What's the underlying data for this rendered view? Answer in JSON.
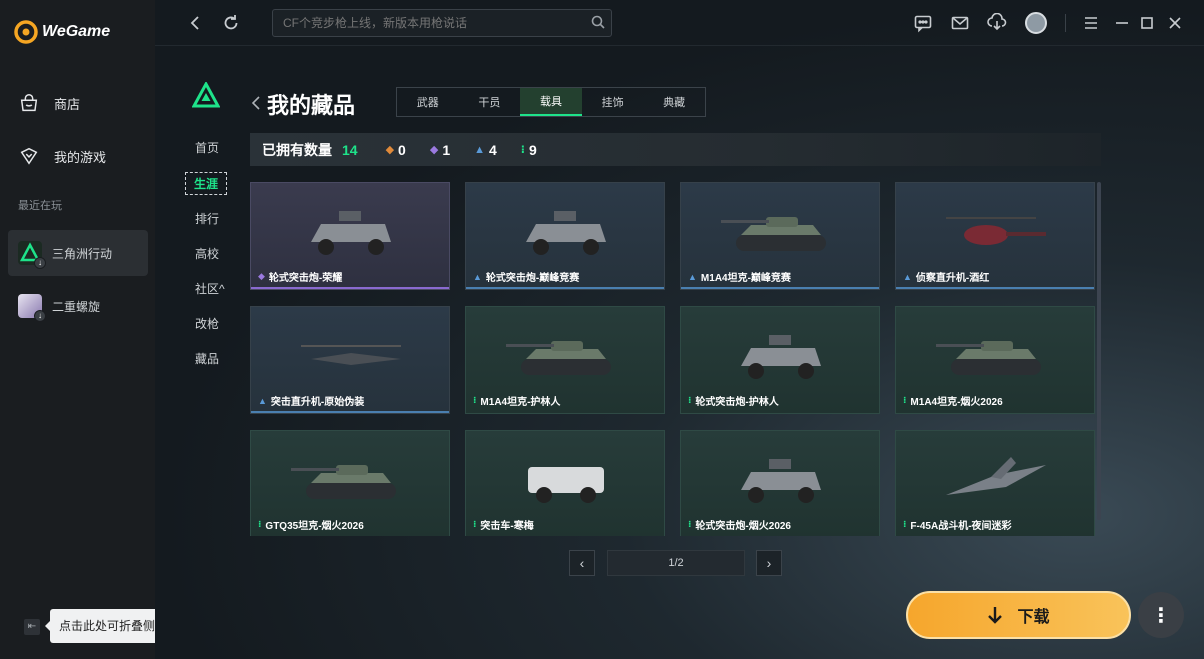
{
  "app": {
    "logo_text": "WeGame",
    "colors": {
      "accent": "#1ee38a",
      "download": "#f6a62c"
    }
  },
  "sidebar": {
    "nav": [
      {
        "label": "商店",
        "icon": "shop-bag-icon"
      },
      {
        "label": "我的游戏",
        "icon": "gamepad-icon"
      }
    ],
    "recent_label": "最近在玩",
    "recent_games": [
      {
        "label": "三角洲行动",
        "active": true
      },
      {
        "label": "二重螺旋",
        "active": false
      }
    ],
    "collapse_tip": "点击此处可折叠侧边栏"
  },
  "topbar": {
    "search_placeholder": "CF个竞步枪上线，新版本用枪说话",
    "icons": [
      "back-icon",
      "refresh-icon",
      "search-icon",
      "chat-icon",
      "mail-icon",
      "download-manager-icon",
      "avatar",
      "menu-icon",
      "minimize-icon",
      "maximize-icon",
      "close-icon"
    ]
  },
  "inner_nav": [
    {
      "label": "首页",
      "active": false
    },
    {
      "label": "生涯",
      "active": true
    },
    {
      "label": "排行",
      "active": false
    },
    {
      "label": "高校",
      "active": false
    },
    {
      "label": "社区^",
      "active": false
    },
    {
      "label": "改枪",
      "active": false
    },
    {
      "label": "藏品",
      "active": false
    }
  ],
  "page": {
    "title": "我的藏品",
    "tabs": [
      {
        "label": "武器",
        "active": false
      },
      {
        "label": "干员",
        "active": false
      },
      {
        "label": "载具",
        "active": true
      },
      {
        "label": "挂饰",
        "active": false
      },
      {
        "label": "典藏",
        "active": false
      }
    ]
  },
  "stats": {
    "label": "已拥有数量",
    "total": "14",
    "tiers": [
      {
        "value": "0",
        "color": "#e08a3a",
        "glyph": "◆"
      },
      {
        "value": "1",
        "color": "#9b7ae0",
        "glyph": "◆"
      },
      {
        "value": "4",
        "color": "#5a9ad8",
        "glyph": "▲"
      },
      {
        "value": "9",
        "color": "#1ee38a",
        "glyph": "⁝"
      }
    ]
  },
  "items": [
    {
      "name": "轮式突击炮-荣耀",
      "rarity": "purple",
      "glyph": "◆",
      "glyph_color": "#9b7ae0",
      "kind": "armored-car"
    },
    {
      "name": "轮式突击炮-巅峰竞赛",
      "rarity": "blue",
      "glyph": "▲",
      "glyph_color": "#5a9ad8",
      "kind": "armored-car"
    },
    {
      "name": "M1A4坦克-巅峰竞赛",
      "rarity": "blue",
      "glyph": "▲",
      "glyph_color": "#5a9ad8",
      "kind": "tank"
    },
    {
      "name": "侦察直升机-酒红",
      "rarity": "blue",
      "glyph": "▲",
      "glyph_color": "#5a9ad8",
      "kind": "helicopter"
    },
    {
      "name": "突击直升机-原始伪装",
      "rarity": "blue",
      "glyph": "▲",
      "glyph_color": "#5a9ad8",
      "kind": "attack-helicopter"
    },
    {
      "name": "M1A4坦克-护林人",
      "rarity": "green",
      "glyph": "⁝",
      "glyph_color": "#1ee38a",
      "kind": "tank"
    },
    {
      "name": "轮式突击炮-护林人",
      "rarity": "green",
      "glyph": "⁝",
      "glyph_color": "#1ee38a",
      "kind": "armored-car"
    },
    {
      "name": "M1A4坦克-烟火2026",
      "rarity": "green",
      "glyph": "⁝",
      "glyph_color": "#1ee38a",
      "kind": "tank"
    },
    {
      "name": "GTQ35坦克-烟火2026",
      "rarity": "green",
      "glyph": "⁝",
      "glyph_color": "#1ee38a",
      "kind": "tank"
    },
    {
      "name": "突击车-寒梅",
      "rarity": "green",
      "glyph": "⁝",
      "glyph_color": "#1ee38a",
      "kind": "truck"
    },
    {
      "name": "轮式突击炮-烟火2026",
      "rarity": "green",
      "glyph": "⁝",
      "glyph_color": "#1ee38a",
      "kind": "armored-car"
    },
    {
      "name": "F-45A战斗机-夜间迷彩",
      "rarity": "green",
      "glyph": "⁝",
      "glyph_color": "#1ee38a",
      "kind": "jet"
    }
  ],
  "pagination": {
    "label": "1/2",
    "prev": "‹",
    "next": "›"
  },
  "download": {
    "label": "下载",
    "more": "⋮"
  }
}
